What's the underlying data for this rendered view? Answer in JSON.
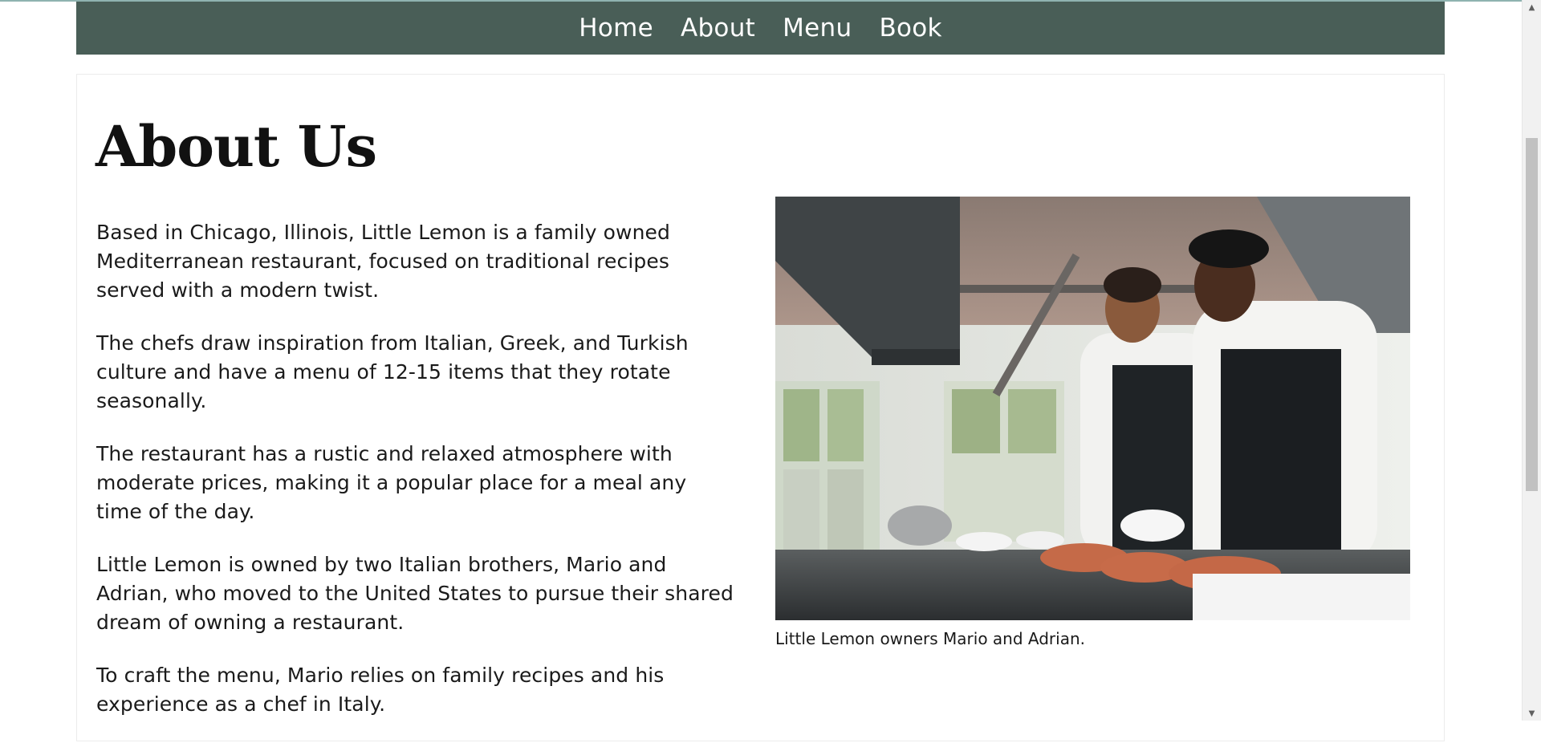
{
  "nav": {
    "items": [
      {
        "label": "Home"
      },
      {
        "label": "About"
      },
      {
        "label": "Menu"
      },
      {
        "label": "Book"
      }
    ]
  },
  "page": {
    "title": "About Us"
  },
  "content": {
    "paragraphs": [
      "Based in Chicago, Illinois, Little Lemon is a family owned Mediterranean restaurant, focused on traditional recipes served with a modern twist.",
      "The chefs draw inspiration from Italian, Greek, and Turkish culture and have a menu of 12-15 items that they rotate seasonally.",
      "The restaurant has a rustic and relaxed atmosphere with moderate prices, making it a popular place for a meal any time of the day.",
      "Little Lemon is owned by two Italian brothers, Mario and Adrian, who moved to the United States to pursue their shared dream of owning a restaurant.",
      "To craft the menu, Mario relies on family recipes and his experience as a chef in Italy."
    ]
  },
  "figure": {
    "caption": "Little Lemon owners Mario and Adrian."
  },
  "icons": {
    "scroll_up": "chevron-up-icon",
    "scroll_down": "chevron-down-icon"
  },
  "colors": {
    "nav_background": "#495e57",
    "nav_text": "#ffffff",
    "heading": "#111111",
    "body_text": "#1a1a1a"
  }
}
